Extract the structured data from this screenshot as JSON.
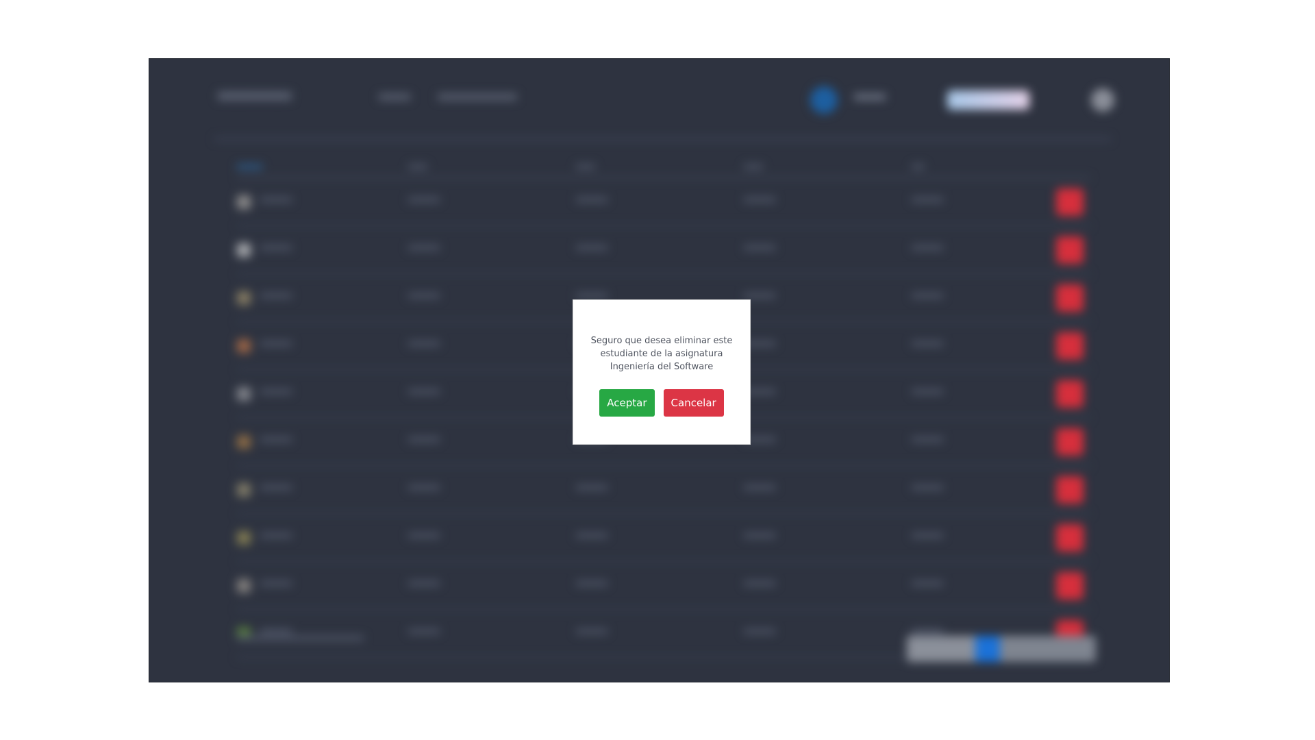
{
  "dialog": {
    "message": "Seguro que desea eliminar este estudiante de la asignatura Ingeniería del Software",
    "accept_label": "Aceptar",
    "cancel_label": "Cancelar"
  },
  "colors": {
    "app_background": "#2e3340",
    "accept_button": "#27a844",
    "cancel_button": "#dc3545",
    "row_delete_button": "#d62f3c",
    "pagination_active": "#1b72d8"
  },
  "background_rows": [
    {
      "thumb_color": "#8b8a8a"
    },
    {
      "thumb_color": "#a7a9ad"
    },
    {
      "thumb_color": "#857b62"
    },
    {
      "thumb_color": "#9a6446"
    },
    {
      "thumb_color": "#80838a"
    },
    {
      "thumb_color": "#8a6a45"
    },
    {
      "thumb_color": "#7f7a67"
    },
    {
      "thumb_color": "#807a52"
    },
    {
      "thumb_color": "#827f7d"
    },
    {
      "thumb_color": "#557a3f"
    }
  ]
}
